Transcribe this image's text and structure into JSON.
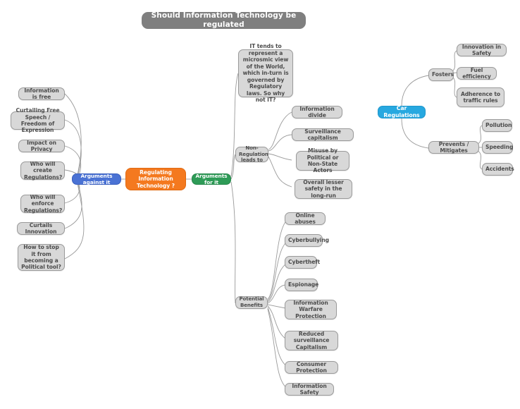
{
  "title": {
    "label": "Should Information Technology be regulated",
    "color": "#7f7f7f"
  },
  "colors": {
    "root": "#f4791f",
    "against": "#4a72d4",
    "for": "#2e9b57",
    "car": "#27a8e0",
    "node_fill": "#d8d8d8",
    "node_border": "#9a9a9a",
    "edge": "#9a9a9a",
    "background": "#ffffff"
  },
  "root": {
    "label": "Regulating Information Technology ?"
  },
  "branches": {
    "against": {
      "label": "Arguments against it",
      "items": [
        {
          "label": "Information is free"
        },
        {
          "label": "Curtailing Free Speech / Freedom of Expression"
        },
        {
          "label": "Impact on Privacy"
        },
        {
          "label": "Who will create Regulations?"
        },
        {
          "label": "Who will enforce Regulations?"
        },
        {
          "label": "Curtails Innovation"
        },
        {
          "label": "How to stop it from becoming a Political tool?"
        }
      ]
    },
    "for": {
      "label": "Arguments for it",
      "items": [
        {
          "label": "IT tends to represent a microsmic view of the World, which in-turn is governed by Regulatory laws. So why not IT?"
        },
        {
          "label": "Non-Regulation leads to"
        },
        {
          "label": "Potential Benefits"
        }
      ]
    },
    "non_regulation": {
      "label": "Non-Regulation leads to",
      "items": [
        {
          "label": "Information divide"
        },
        {
          "label": "Surveillance capitalism"
        },
        {
          "label": "Misuse by Political or Non-State Actors"
        },
        {
          "label": "Overall lesser safety in the long-run"
        }
      ]
    },
    "potential_benefits": {
      "label": "Potential Benefits",
      "items": [
        {
          "label": "Online abuses"
        },
        {
          "label": "Cyberbullying"
        },
        {
          "label": "Cybertheft"
        },
        {
          "label": "Espionage"
        },
        {
          "label": "Information Warfare Protection"
        },
        {
          "label": "Reduced surveillance Capitalism"
        },
        {
          "label": "Consumer Protection"
        },
        {
          "label": "Information Safety"
        }
      ]
    },
    "car": {
      "label": "Car Regulations",
      "groups": [
        {
          "label": "Fosters",
          "items": [
            {
              "label": "Innovation in Safety"
            },
            {
              "label": "Fuel efficiency"
            },
            {
              "label": "Adherence to traffic rules"
            }
          ]
        },
        {
          "label": "Prevents / Mitigates",
          "items": [
            {
              "label": "Pollution"
            },
            {
              "label": "Speeding"
            },
            {
              "label": "Accidents"
            }
          ]
        }
      ]
    }
  }
}
